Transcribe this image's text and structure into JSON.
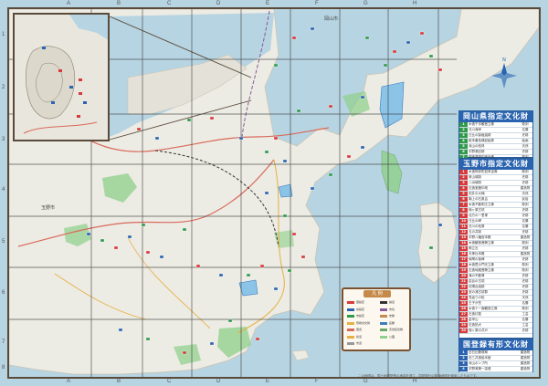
{
  "grid": {
    "columns": [
      "A",
      "B",
      "C",
      "D",
      "E",
      "F",
      "G",
      "H"
    ],
    "rows": [
      "1",
      "2",
      "3",
      "4",
      "5",
      "6",
      "7",
      "8"
    ]
  },
  "colors": {
    "sea": "#b7d4e2",
    "land": "#ecebe4",
    "panel_header": "#2a64b0",
    "legend_border": "#7a5230",
    "green_area": "#8fd08a"
  },
  "map_labels": {
    "city_center": "玉野市",
    "north_label": "岡山市"
  },
  "legend": {
    "title": "凡 例",
    "items": [
      "国指定",
      "県指定",
      "市指定",
      "登録文化財",
      "国道",
      "県道",
      "市道",
      "鉄道",
      "市境",
      "史跡",
      "名勝",
      "天然記念物",
      "公園"
    ]
  },
  "panels": {
    "okayama": {
      "title": "岡山県指定文化財",
      "rows": [
        {
          "name": "木造千手観音立像",
          "kind": "彫刻"
        },
        {
          "name": "渋川海岸",
          "kind": "名勝"
        },
        {
          "name": "日比の製塩遺跡",
          "kind": "史跡"
        },
        {
          "name": "紙本著色縁起絵巻",
          "kind": "絵画"
        },
        {
          "name": "深山の松林",
          "kind": "天然"
        },
        {
          "name": "宇野港旧跡",
          "kind": "史跡"
        },
        {
          "name": "銅造薬師如来坐像",
          "kind": "彫刻"
        },
        {
          "name": "石造五重塔",
          "kind": "建造物"
        }
      ]
    },
    "tamano": {
      "title": "玉野市指定文化財",
      "rows": [
        {
          "name": "木造阿弥陀如来坐像",
          "kind": "彫刻"
        },
        {
          "name": "常山城跡",
          "kind": "史跡"
        },
        {
          "name": "八浜城跡",
          "kind": "史跡"
        },
        {
          "name": "石造宝篋印塔",
          "kind": "建造物"
        },
        {
          "name": "田井の大楠",
          "kind": "天然"
        },
        {
          "name": "胸上の石風呂",
          "kind": "民俗"
        },
        {
          "name": "木造不動明王立像",
          "kind": "彫刻"
        },
        {
          "name": "槌ヶ原古墳",
          "kind": "史跡"
        },
        {
          "name": "北方の一里塚",
          "kind": "史跡"
        },
        {
          "name": "日比の岬",
          "kind": "名勝"
        },
        {
          "name": "渋川の松原",
          "kind": "名勝"
        },
        {
          "name": "玉の井跡",
          "kind": "史跡"
        },
        {
          "name": "宇野八幡宮本殿",
          "kind": "建造物"
        },
        {
          "name": "木造観音菩薩立像",
          "kind": "彫刻"
        },
        {
          "name": "鉾立石",
          "kind": "史跡"
        },
        {
          "name": "天神社本殿",
          "kind": "建造物"
        },
        {
          "name": "後閑の板碑",
          "kind": "史跡"
        },
        {
          "name": "木造毘沙門天立像",
          "kind": "彫刻"
        },
        {
          "name": "石造地蔵菩薩立像",
          "kind": "彫刻"
        },
        {
          "name": "滝の不動尊",
          "kind": "史跡"
        },
        {
          "name": "岩谷の古墳",
          "kind": "史跡"
        },
        {
          "name": "紅陽台遺跡",
          "kind": "史跡"
        },
        {
          "name": "宮の浦古墳群",
          "kind": "史跡"
        },
        {
          "name": "見返りの松",
          "kind": "天然"
        },
        {
          "name": "王子が岳",
          "kind": "名勝"
        },
        {
          "name": "木造十一面観音立像",
          "kind": "彫刻"
        },
        {
          "name": "石造灯籠",
          "kind": "工芸"
        },
        {
          "name": "金甲山",
          "kind": "名勝"
        },
        {
          "name": "石造狛犬",
          "kind": "工芸"
        },
        {
          "name": "槌ヶ原の井戸",
          "kind": "史跡"
        }
      ]
    },
    "national": {
      "title": "国登録有形文化財",
      "rows": [
        {
          "name": "旧日比郵便局",
          "kind": "建造物"
        },
        {
          "name": "旧三井造船本館",
          "kind": "建造物"
        },
        {
          "name": "深山ポンプ所",
          "kind": "建造物"
        },
        {
          "name": "宇野港第一突堤",
          "kind": "建造物"
        }
      ]
    }
  },
  "footer": {
    "note": "この地図は、国土地理院長の承認を得て、同院発行の数値地図を使用したものです。"
  }
}
